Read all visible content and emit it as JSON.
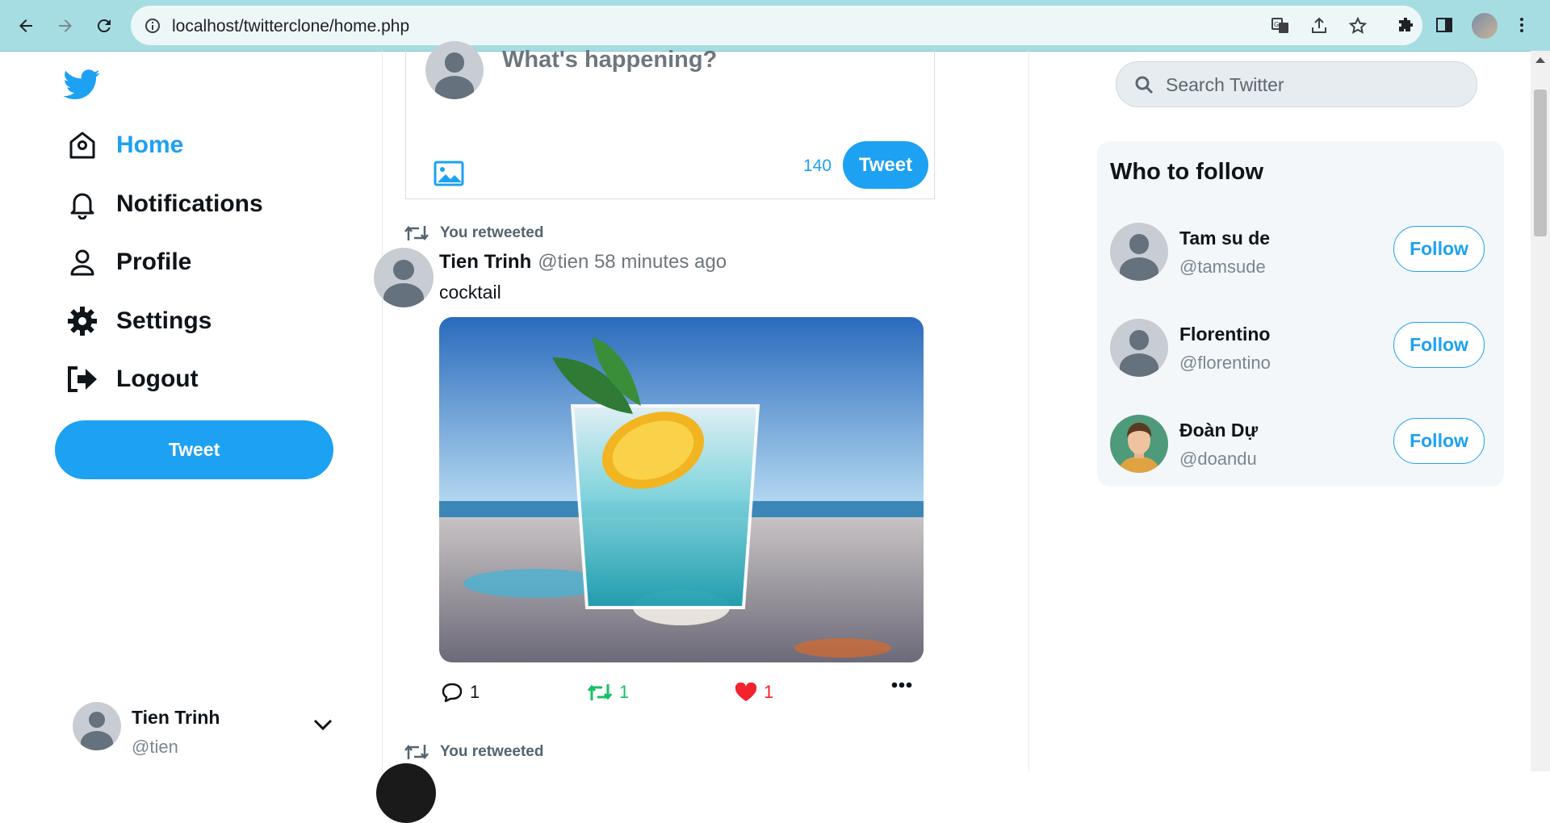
{
  "browser": {
    "url": "localhost/twitterclone/home.php",
    "back_icon": "arrow-left-icon",
    "forward_icon": "arrow-right-icon",
    "reload_icon": "reload-icon"
  },
  "sidebar": {
    "nav": [
      {
        "label": "Home",
        "icon": "home-icon",
        "active": true
      },
      {
        "label": "Notifications",
        "icon": "bell-icon",
        "active": false
      },
      {
        "label": "Profile",
        "icon": "person-icon",
        "active": false
      },
      {
        "label": "Settings",
        "icon": "gear-icon",
        "active": false
      },
      {
        "label": "Logout",
        "icon": "logout-icon",
        "active": false
      }
    ],
    "tweet_button": "Tweet",
    "account": {
      "name": "Tien Trinh",
      "handle": "@tien"
    }
  },
  "composer": {
    "placeholder": "What's happening?",
    "char_count": "140",
    "tweet_button": "Tweet"
  },
  "feed": [
    {
      "retweet_label": "You retweeted",
      "name": "Tien Trinh",
      "meta": "@tien 58 minutes ago",
      "text": "cocktail",
      "replies": "1",
      "retweets": "1",
      "likes": "1"
    },
    {
      "retweet_label": "You retweeted"
    }
  ],
  "right": {
    "search_placeholder": "Search Twitter",
    "who_to_follow_title": "Who to follow",
    "suggestions": [
      {
        "name": "Tam su de",
        "handle": "@tamsude",
        "button": "Follow"
      },
      {
        "name": "Florentino",
        "handle": "@florentino",
        "button": "Follow"
      },
      {
        "name": "Đoàn Dự",
        "handle": "@doandu",
        "button": "Follow"
      }
    ]
  },
  "colors": {
    "brand": "#1da1f2",
    "retweet": "#17bf63",
    "like": "#f4212e",
    "chrome": "#a6dde3"
  }
}
